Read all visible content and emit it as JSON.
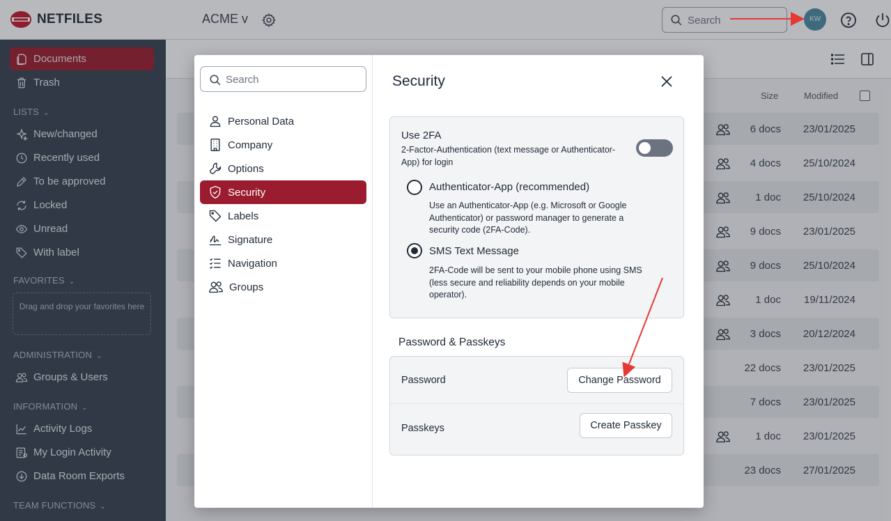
{
  "app": {
    "logo_text": "NETFILES",
    "account_label": "ACME v",
    "search_placeholder": "Search",
    "avatar_initials": "KW",
    "brand_color": "#9b1c2e"
  },
  "sidebar": {
    "items": [
      {
        "label": "Documents",
        "icon": "document-icon"
      },
      {
        "label": "Trash",
        "icon": "trash-icon"
      }
    ],
    "lists_heading": "LISTS",
    "lists": [
      {
        "label": "New/changed",
        "icon": "sparkle-icon"
      },
      {
        "label": "Recently used",
        "icon": "clock-icon"
      },
      {
        "label": "To be approved",
        "icon": "pencil-icon"
      },
      {
        "label": "Locked",
        "icon": "refresh-icon"
      },
      {
        "label": "Unread",
        "icon": "eye-icon"
      },
      {
        "label": "With label",
        "icon": "tag-icon"
      }
    ],
    "favorites_heading": "FAVORITES",
    "favorites_hint": "Drag and drop your favorites here",
    "administration_heading": "ADMINISTRATION",
    "administration": [
      {
        "label": "Groups & Users",
        "icon": "users-icon"
      }
    ],
    "information_heading": "INFORMATION",
    "information": [
      {
        "label": "Activity Logs",
        "icon": "chart-icon"
      },
      {
        "label": "My Login Activity",
        "icon": "list-icon"
      },
      {
        "label": "Data Room Exports",
        "icon": "download-icon"
      }
    ],
    "team_heading": "TEAM FUNCTIONS"
  },
  "listing": {
    "headers": {
      "size": "Size",
      "modified": "Modified"
    },
    "rows": [
      {
        "size": "6 docs",
        "modified": "23/01/2025",
        "shared": true
      },
      {
        "size": "4 docs",
        "modified": "25/10/2024",
        "shared": true
      },
      {
        "size": "1 doc",
        "modified": "25/10/2024",
        "shared": true
      },
      {
        "size": "9 docs",
        "modified": "23/01/2025",
        "shared": true
      },
      {
        "size": "9 docs",
        "modified": "25/10/2024",
        "shared": true
      },
      {
        "size": "1 doc",
        "modified": "19/11/2024",
        "shared": true
      },
      {
        "size": "3 docs",
        "modified": "20/12/2024",
        "shared": true
      },
      {
        "size": "22 docs",
        "modified": "23/01/2025",
        "shared": false
      },
      {
        "size": "7 docs",
        "modified": "23/01/2025",
        "shared": false
      },
      {
        "size": "1 doc",
        "modified": "23/01/2025",
        "shared": true
      },
      {
        "size": "23 docs",
        "modified": "27/01/2025",
        "shared": false
      }
    ]
  },
  "modal": {
    "search_placeholder": "Search",
    "nav": [
      {
        "label": "Personal Data",
        "icon": "person-icon"
      },
      {
        "label": "Company",
        "icon": "building-icon"
      },
      {
        "label": "Options",
        "icon": "wrench-icon"
      },
      {
        "label": "Security",
        "icon": "shield-icon",
        "active": true
      },
      {
        "label": "Labels",
        "icon": "tag-icon"
      },
      {
        "label": "Signature",
        "icon": "signature-icon"
      },
      {
        "label": "Navigation",
        "icon": "checklist-icon"
      },
      {
        "label": "Groups",
        "icon": "users-icon"
      }
    ],
    "title": "Security",
    "twofa": {
      "title": "Use 2FA",
      "description": "2-Factor-Authentication (text message or Authenticator-App) for login",
      "enabled": false,
      "options": [
        {
          "title": "Authenticator-App (recommended)",
          "description": "Use an Authenticator-App (e.g. Microsoft or Google Authenticator) or password manager to generate a security code (2FA-Code).",
          "selected": false
        },
        {
          "title": "SMS Text Message",
          "description": "2FA-Code will be sent to your mobile phone using SMS (less secure and reliability depends on your mobile operator).",
          "selected": true
        }
      ]
    },
    "password_section": {
      "heading": "Password & Passkeys",
      "password_label": "Password",
      "change_password_button": "Change Password",
      "passkeys_label": "Passkeys",
      "create_passkey_button": "Create Passkey"
    }
  }
}
